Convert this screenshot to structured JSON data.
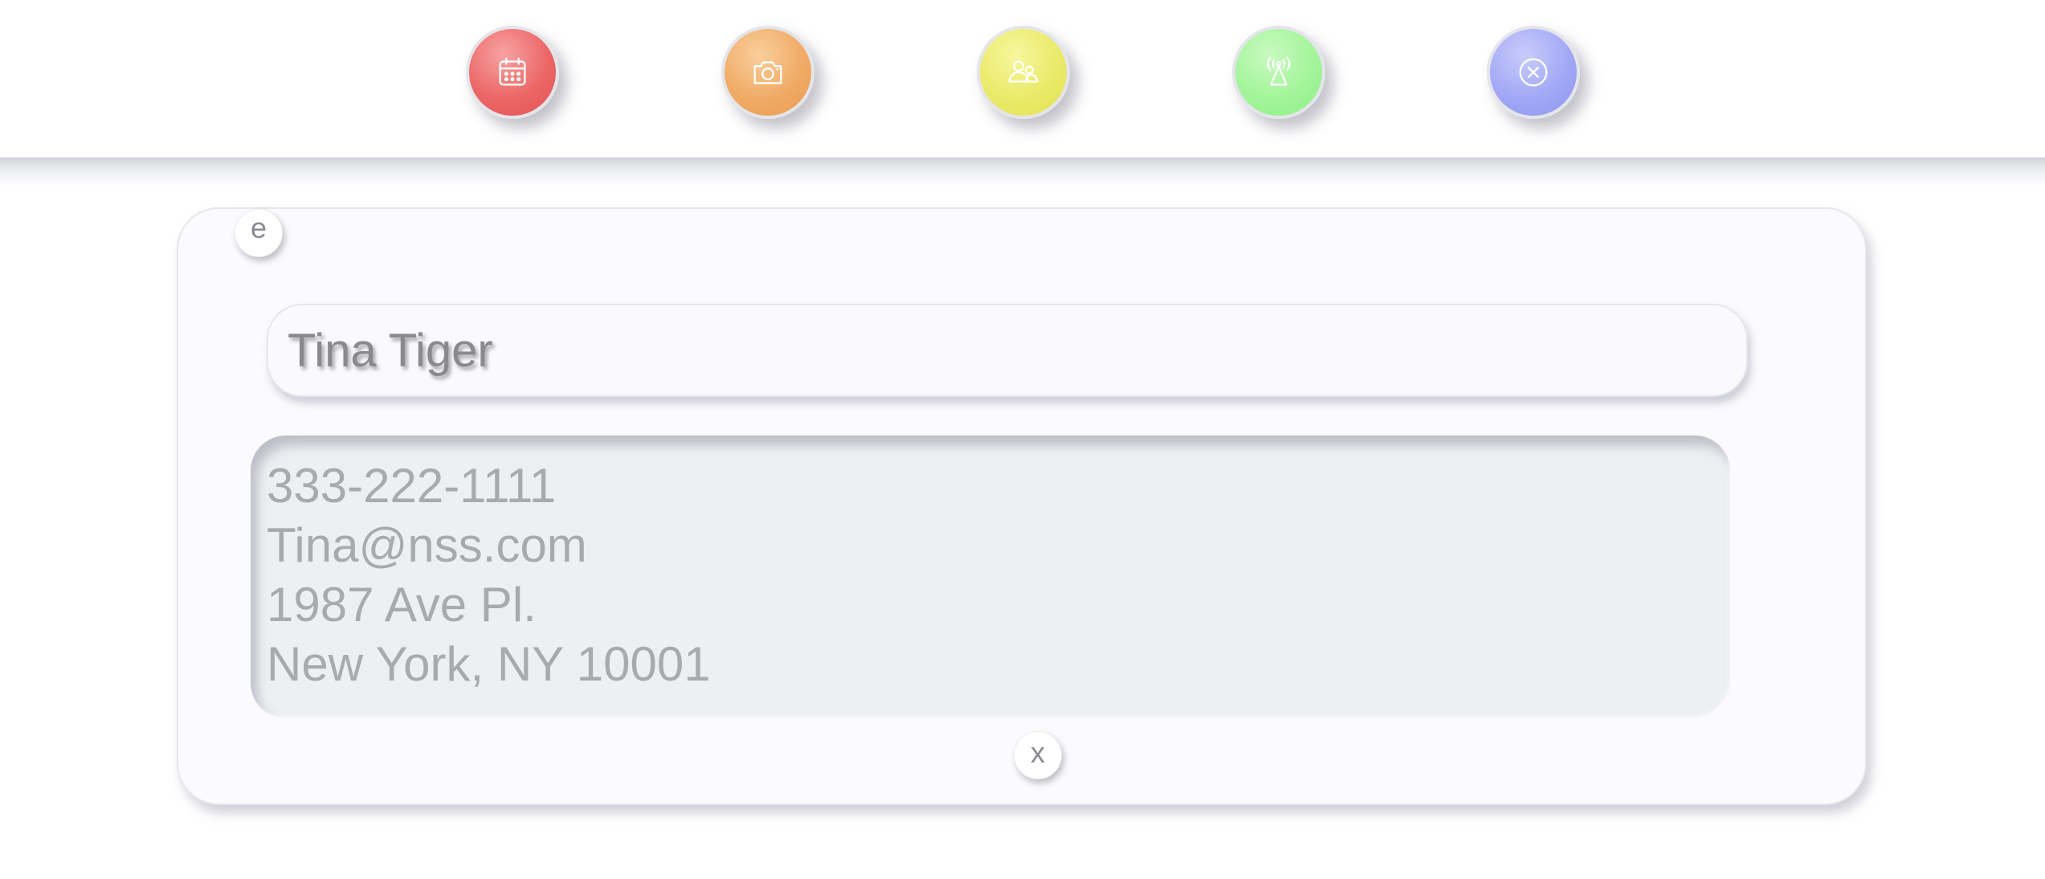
{
  "toolbar": {
    "buttons": [
      {
        "id": "calendar",
        "icon": "calendar-icon",
        "color": "#ec6767"
      },
      {
        "id": "camera",
        "icon": "camera-icon",
        "color": "#f0ab66"
      },
      {
        "id": "contacts",
        "icon": "contacts-icon",
        "color": "#eaea6a"
      },
      {
        "id": "signal",
        "icon": "broadcast-tower-icon",
        "color": "#a3f59a"
      },
      {
        "id": "close",
        "icon": "close-circle-icon",
        "color": "#a2a8f5"
      }
    ]
  },
  "card": {
    "edit_label": "e",
    "close_label": "x",
    "name": "Tina Tiger",
    "details": [
      "333-222-1111",
      "Tina@nss.com",
      "1987 Ave Pl.",
      "New York, NY 10001"
    ]
  }
}
